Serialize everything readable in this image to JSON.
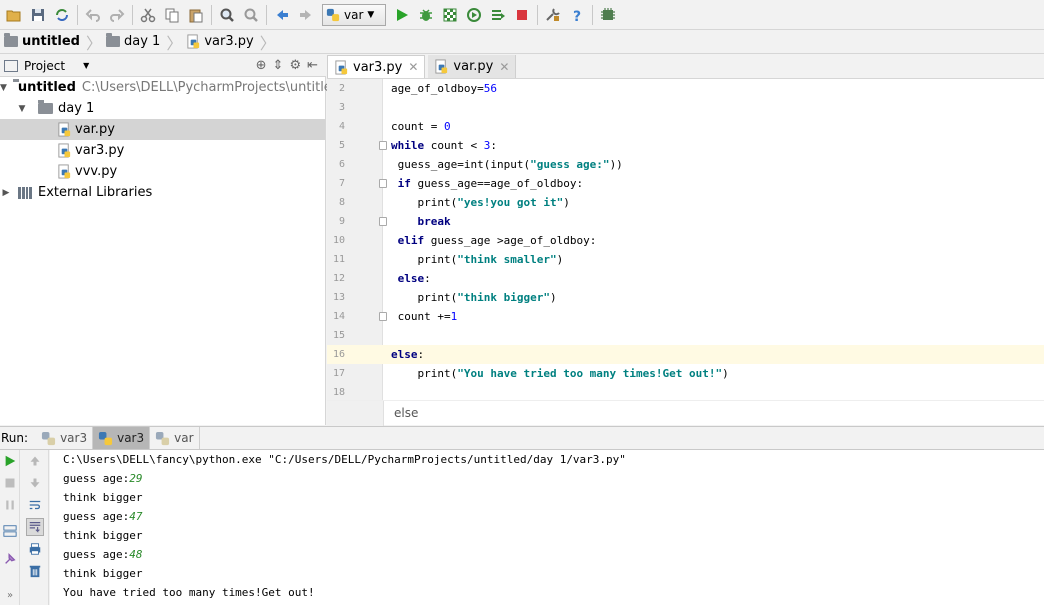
{
  "toolbar": {
    "run_config": "var",
    "buttons": [
      "open-icon",
      "save-icon",
      "sync-icon",
      "undo-icon",
      "redo-icon",
      "cut-icon",
      "copy-icon",
      "paste-icon",
      "find-icon",
      "replace-icon",
      "back-icon",
      "forward-icon",
      "run-icon",
      "debug-icon",
      "coverage-icon",
      "profile-icon",
      "concurrency-icon",
      "stop-icon",
      "settings-icon",
      "help-icon",
      "sdk-icon"
    ]
  },
  "breadcrumb": {
    "items": [
      "untitled",
      "day 1",
      "var3.py"
    ]
  },
  "project_panel": {
    "title": "Project",
    "tree": {
      "root_name": "untitled",
      "root_path": "C:\\Users\\DELL\\PycharmProjects\\untitled",
      "folder": "day 1",
      "files": [
        "var.py",
        "var3.py",
        "vvv.py"
      ],
      "libraries": "External Libraries"
    }
  },
  "editor": {
    "tabs": [
      {
        "label": "var3.py",
        "active": true
      },
      {
        "label": "var.py",
        "active": false
      }
    ],
    "lines": [
      {
        "n": "2",
        "text": "age_of_oldboy=56"
      },
      {
        "n": "3",
        "text": ""
      },
      {
        "n": "4",
        "text": "count = 0"
      },
      {
        "n": "5",
        "text": "while count < 3:"
      },
      {
        "n": "6",
        "text": " guess_age=int(input(\"guess age:\"))"
      },
      {
        "n": "7",
        "text": " if guess_age==age_of_oldboy:"
      },
      {
        "n": "8",
        "text": "    print(\"yes!you got it\")"
      },
      {
        "n": "9",
        "text": "    break"
      },
      {
        "n": "10",
        "text": " elif guess_age >age_of_oldboy:"
      },
      {
        "n": "11",
        "text": "    print(\"think smaller\")"
      },
      {
        "n": "12",
        "text": " else:"
      },
      {
        "n": "13",
        "text": "    print(\"think bigger\")"
      },
      {
        "n": "14",
        "text": " count +=1"
      },
      {
        "n": "15",
        "text": ""
      },
      {
        "n": "16",
        "text": "else:"
      },
      {
        "n": "17",
        "text": "    print(\"You have tried too many times!Get out!\")"
      },
      {
        "n": "18",
        "text": ""
      }
    ],
    "footer_crumb": "else"
  },
  "run_panel": {
    "label": "Run:",
    "tabs": [
      {
        "label": "var3",
        "active": false
      },
      {
        "label": "var3",
        "active": true
      },
      {
        "label": "var",
        "active": false
      }
    ],
    "console": {
      "command": "C:\\Users\\DELL\\fancy\\python.exe \"C:/Users/DELL/PycharmProjects/untitled/day 1/var3.py\"",
      "prompt": "guess age:",
      "inputs": [
        "29",
        "47",
        "48"
      ],
      "responses": [
        "think bigger",
        "think bigger",
        "think bigger"
      ],
      "final": "You have tried too many times!Get out!"
    }
  },
  "colors": {
    "keyword": "#000080",
    "string": "#008080",
    "number": "#0000ff",
    "current_line": "#fffae3",
    "console_input": "#2a8a2a"
  }
}
